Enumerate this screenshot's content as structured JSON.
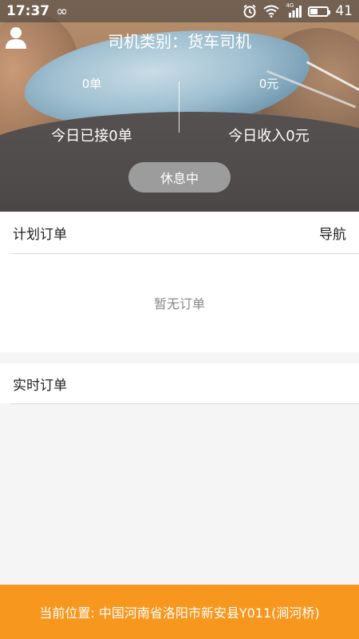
{
  "status_bar": {
    "time": "17:37",
    "infinity_symbol": "∞",
    "battery_level": "41",
    "battery_fill_percent": 41,
    "signal_label": "4G",
    "icons": [
      "alarm-icon",
      "wifi-icon",
      "cell-signal-icon",
      "battery-icon"
    ]
  },
  "header": {
    "title": "司机类别：货车司机",
    "orders_value": "0单",
    "orders_label": "今日已接0单",
    "income_value": "0元",
    "income_label": "今日收入0元",
    "status_button": "休息中"
  },
  "plan_orders": {
    "title": "计划订单",
    "nav_link": "导航",
    "empty_text": "暂无订单"
  },
  "realtime_orders": {
    "title": "实时订单"
  },
  "location": {
    "text": "当前位置: 中国河南省洛阳市新安县Y011(涧河桥)"
  },
  "colors": {
    "accent": "#f7971e",
    "button_bg": "#aaaaaa",
    "divider": "#dcdcdc"
  }
}
